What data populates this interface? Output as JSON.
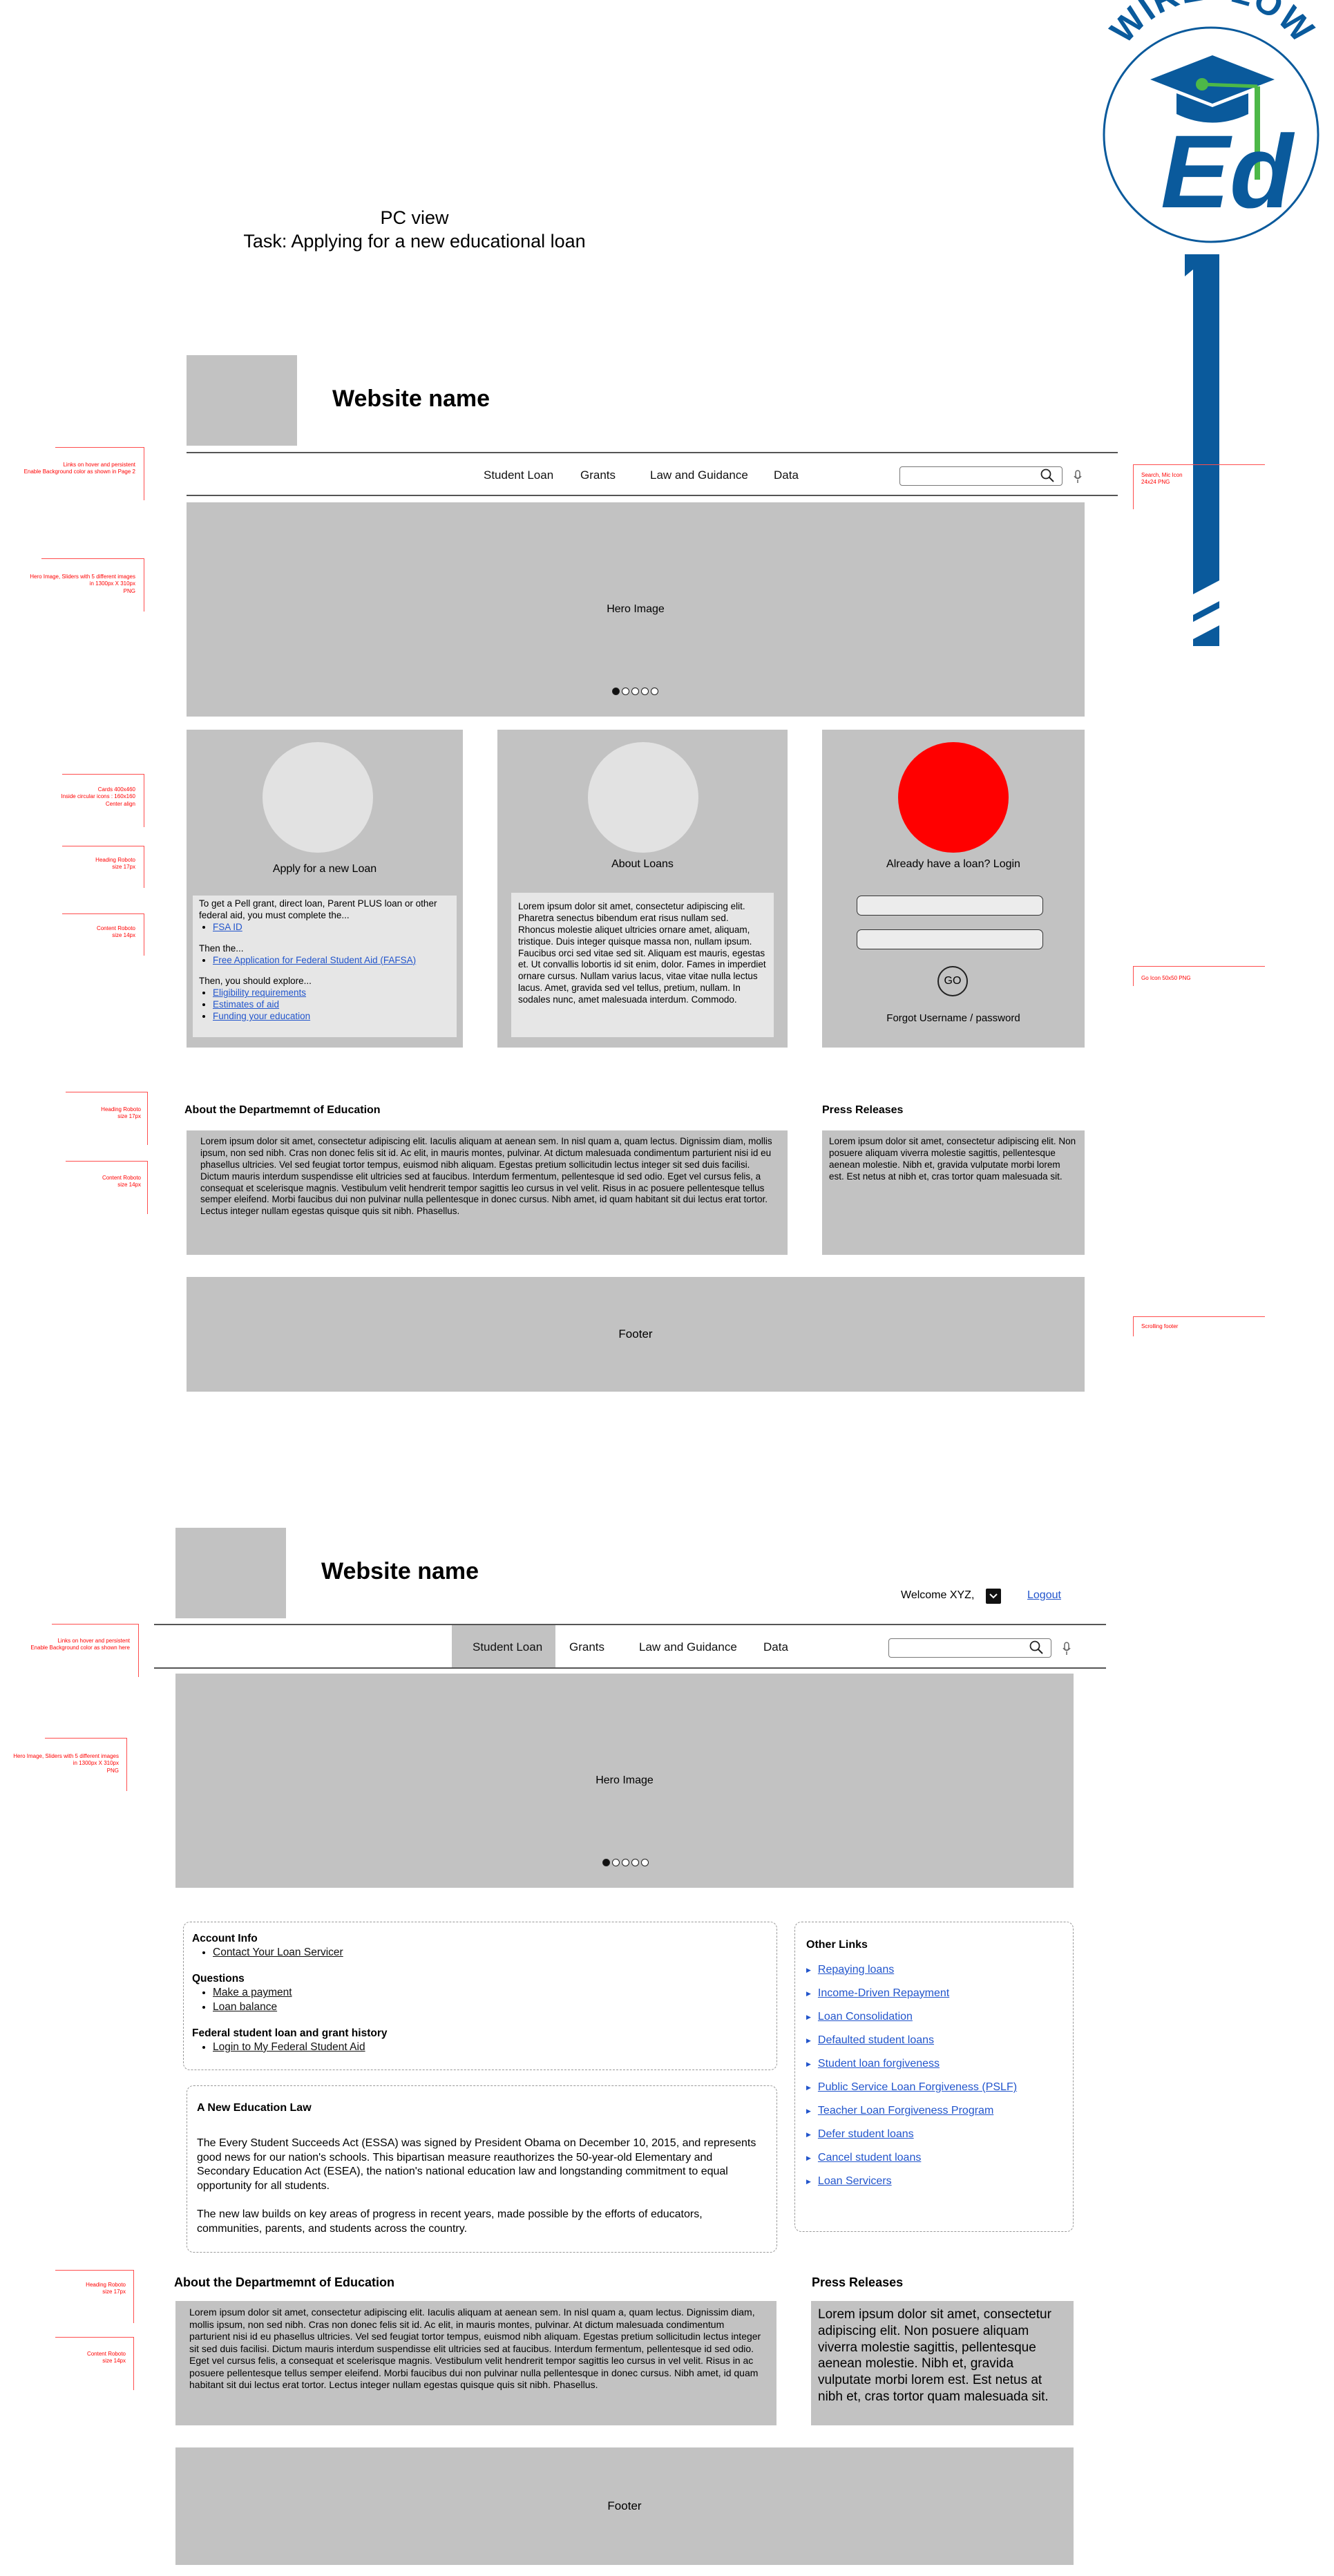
{
  "page": {
    "title_line1": "PC  view",
    "title_line2": "Task: Applying for a new educational loan"
  },
  "logo": {
    "word": "WIREFLOW",
    "letters": "Ed",
    "brand_blue": "#0a5a9c",
    "brand_green": "#4db848"
  },
  "view1": {
    "site_name": "Website name",
    "nav": [
      "Student Loan",
      "Grants",
      "Law and Guidance",
      "Data"
    ],
    "hero_label": "Hero Image",
    "cards": {
      "apply": {
        "title": "Apply for a new Loan",
        "intro": "To get a Pell grant, direct loan, Parent PLUS loan or other federal aid, you must complete the...",
        "fsa": "FSA ID",
        "then": "Then the...",
        "fafsa": "Free Application for Federal Student Aid (FAFSA)",
        "explore": "Then, you should explore...",
        "links": [
          "Eligibility requirements",
          "Estimates of aid",
          "Funding your education"
        ]
      },
      "about": {
        "title": "About Loans",
        "text": "Lorem ipsum dolor sit amet, consectetur adipiscing elit. Pharetra senectus bibendum erat risus nullam sed. Rhoncus molestie aliquet ultricies ornare amet, aliquam, tristique. Duis integer quisque massa non, nullam ipsum. Faucibus orci sed vitae sed sit. Aliquam est mauris, egestas et. Ut convallis lobortis id sit enim, dolor. Fames in imperdiet ornare cursus. Nullam varius lacus, vitae vitae nulla lectus lacus. Amet, gravida sed vel tellus, pretium, nullam. In sodales nunc, amet malesuada interdum. Commodo."
      },
      "login": {
        "title": "Already have a loan?  Login",
        "go": "GO",
        "forgot": "Forgot Username / password",
        "circle_color": "#ff0000"
      }
    },
    "about_dept": {
      "heading": "About the  Departmemnt of Education",
      "text": "Lorem ipsum dolor sit amet, consectetur adipiscing elit. Iaculis aliquam at aenean sem. In nisl quam a, quam lectus. Dignissim diam, mollis ipsum, non sed nibh. Cras non donec felis sit id. Ac elit, in mauris montes, pulvinar. At dictum malesuada condimentum parturient nisi id eu phasellus ultricies. Vel sed feugiat tortor tempus, euismod nibh aliquam. Egestas pretium sollicitudin lectus integer sit sed duis facilisi. Dictum mauris interdum suspendisse elit ultricies sed at faucibus. Interdum fermentum, pellentesque id sed odio. Eget vel cursus felis, a consequat et scelerisque magnis. Vestibulum velit hendrerit tempor sagittis leo cursus in vel velit. Risus in ac posuere pellentesque tellus semper eleifend. Morbi faucibus dui non pulvinar nulla pellentesque in donec cursus. Nibh amet, id quam habitant sit dui lectus erat tortor. Lectus integer nullam egestas quisque quis sit nibh. Phasellus."
    },
    "press": {
      "heading": "Press Releases",
      "text": "Lorem ipsum dolor sit amet, consectetur adipiscing elit. Non posuere aliquam viverra molestie sagittis, pellentesque aenean molestie. Nibh et, gravida vulputate morbi lorem est. Est netus at nibh et, cras tortor quam malesuada sit."
    },
    "footer": "Footer",
    "annotations": {
      "links": "Links on hover and persistent\nEnable Background color as shown in Page 2",
      "hero": "Hero Image, Sliders with 5 different images\nin 1300px X 310px\nPNG",
      "cards": "Cards 400x460\nInside circular icons : 160x160\nCenter align",
      "heading": "Heading Roboto\nsize 17px",
      "content": "Content Roboto\nsize 14px",
      "heading2": "Heading Roboto\nsize 17px",
      "content2": "Content Roboto\nsize 14px",
      "search": "Search, Mic Icon\n24x24 PNG",
      "go": "Go Icon 50x50 PNG",
      "footer": "Scrolling footer"
    }
  },
  "view2": {
    "site_name": "Website name",
    "welcome": "Welcome XYZ,",
    "logout": "Logout",
    "nav": [
      "Student Loan",
      "Grants",
      "Law and Guidance",
      "Data"
    ],
    "hero_label": "Hero Image",
    "account": {
      "heading": "Account Info",
      "contact": "Contact Your Loan Servicer",
      "questions_heading": "Questions",
      "questions": [
        "Make a payment",
        "Loan balance"
      ],
      "history_heading": "Federal student loan and grant history",
      "history_link": "Login to My Federal Student Aid"
    },
    "news": {
      "heading": "A New Education Law",
      "p1": "The Every Student Succeeds Act (ESSA) was signed by President Obama on December 10, 2015, and represents good news for our nation's schools. This bipartisan measure reauthorizes the 50-year-old Elementary and Secondary Education Act (ESEA), the nation's national education law and longstanding commitment to equal opportunity for all students.",
      "p2": "The new law builds on key areas of progress in recent years, made possible by the efforts of educators, communities, parents, and students across the country."
    },
    "other_links": {
      "heading": "Other Links",
      "items": [
        "Repaying loans",
        "Income-Driven Repayment",
        "Loan Consolidation",
        "Defaulted student loans",
        "Student loan forgiveness",
        "Public Service Loan Forgiveness (PSLF)",
        "Teacher Loan Forgiveness Program",
        "Defer student loans",
        "Cancel student loans",
        "Loan Servicers"
      ]
    },
    "about_dept": {
      "heading": "About the  Departmemnt of Education",
      "text": "Lorem ipsum dolor sit amet, consectetur adipiscing elit. Iaculis aliquam at aenean sem. In nisl quam a, quam lectus. Dignissim diam, mollis ipsum, non sed nibh. Cras non donec felis sit id. Ac elit, in mauris montes, pulvinar. At dictum malesuada condimentum parturient nisi id eu phasellus ultricies. Vel sed feugiat tortor tempus, euismod nibh aliquam. Egestas pretium sollicitudin lectus integer sit sed duis facilisi. Dictum mauris interdum suspendisse elit ultricies sed at faucibus. Interdum fermentum, pellentesque id sed odio. Eget vel cursus felis, a consequat et scelerisque magnis. Vestibulum velit hendrerit tempor sagittis leo cursus in vel velit. Risus in ac posuere pellentesque tellus semper eleifend. Morbi faucibus dui non pulvinar nulla pellentesque in donec cursus. Nibh amet, id quam habitant sit dui lectus erat tortor. Lectus integer nullam egestas quisque quis sit nibh. Phasellus."
    },
    "press": {
      "heading": "Press Releases",
      "text": "Lorem ipsum dolor sit amet, consectetur adipiscing elit. Non posuere aliquam viverra molestie sagittis, pellentesque aenean molestie. Nibh et, gravida vulputate morbi lorem est. Est netus at nibh et, cras tortor quam malesuada sit."
    },
    "footer": "Footer",
    "annotations": {
      "links": "Links on hover and persistent\nEnable Background color as shown here",
      "hero": "Hero Image, Sliders with 5 different images\nin 1300px X 310px\nPNG",
      "heading": "Heading Roboto\nsize 17px",
      "content": "Content Roboto\nsize 14px"
    }
  }
}
